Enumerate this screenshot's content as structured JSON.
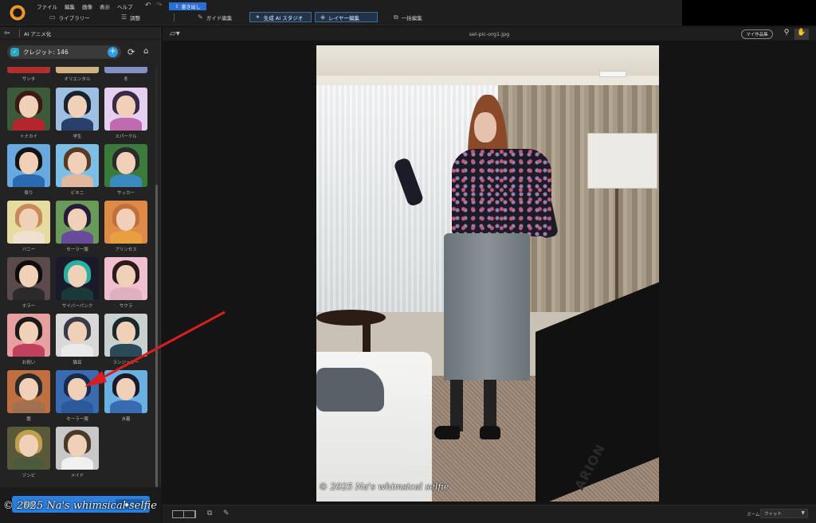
{
  "menu": [
    "ファイル",
    "編集",
    "画像",
    "表示",
    "ヘルプ"
  ],
  "export_label": "書き出し",
  "tabs": {
    "library": "ライブラリー",
    "adjust": "調整",
    "guide_edit": "ガイド編集",
    "gen_ai_studio": "生成 AI スタジオ",
    "layer_edit": "レイヤー編集",
    "batch_edit": "一括編集"
  },
  "left_panel": {
    "title": "AI アニメ化",
    "credits": "クレジット: 146",
    "top_row": [
      "サンタ",
      "オリエンタル",
      "冬"
    ],
    "styles": [
      {
        "label": "トナカイ",
        "hair": "#3a1a12",
        "body": "#b52530",
        "bg": "#3a5a3a"
      },
      {
        "label": "学生",
        "hair": "#1a2230",
        "body": "#28406a",
        "bg": "#9ec0e0"
      },
      {
        "label": "スパークル",
        "hair": "#3a2a4a",
        "body": "#c06ab0",
        "bg": "#e6d0f0"
      },
      {
        "label": "祭り",
        "hair": "#141414",
        "body": "#2a6ab0",
        "bg": "#6aa8e0"
      },
      {
        "label": "ビキニ",
        "hair": "#5a3a22",
        "body": "#e0b8a0",
        "bg": "#7ac0e6"
      },
      {
        "label": "サッカー",
        "hair": "#2a2a2a",
        "body": "#3a8ac0",
        "bg": "#3a7a3a"
      },
      {
        "label": "バニー",
        "hair": "#c88a5a",
        "body": "#f0e0d0",
        "bg": "#e6dca0"
      },
      {
        "label": "セーラー服",
        "hair": "#2a1a3a",
        "body": "#6a4a9a",
        "bg": "#6a9a5a"
      },
      {
        "label": "プリンセス",
        "hair": "#c0703a",
        "body": "#e6a040",
        "bg": "#e08a4a"
      },
      {
        "label": "ホラー",
        "hair": "#0e0e0e",
        "body": "#2a2a2a",
        "bg": "#5a4a4a"
      },
      {
        "label": "サイバーパンク",
        "hair": "#2ab0a0",
        "body": "#1a3a3a",
        "bg": "#1a1a2a"
      },
      {
        "label": "サクラ",
        "hair": "#2a1a1a",
        "body": "#e0b0c0",
        "bg": "#f0c0d0"
      },
      {
        "label": "お祝い",
        "hair": "#1a1a1a",
        "body": "#c04060",
        "bg": "#e6a0a0"
      },
      {
        "label": "猫耳",
        "hair": "#3a3a4a",
        "body": "#eaeaea",
        "bg": "#d8d8d8"
      },
      {
        "label": "ランジェリー",
        "hair": "#1a2a2a",
        "body": "#2a4a5a",
        "bg": "#c8d0d0"
      },
      {
        "label": "龍",
        "hair": "#2a2a2a",
        "body": "#a07050",
        "bg": "#c07040"
      },
      {
        "label": "セーラー服",
        "hair": "#1a2a4a",
        "body": "#2a5a9a",
        "bg": "#3a6ab0"
      },
      {
        "label": "水着",
        "hair": "#1a1a2a",
        "body": "#3a6ab0",
        "bg": "#6ab0e0"
      },
      {
        "label": "ゾンビ",
        "hair": "#c0a050",
        "body": "#4a5a3a",
        "bg": "#5a5a3a"
      },
      {
        "label": "メイド",
        "hair": "#4a3a2a",
        "body": "#f0f0f0",
        "bg": "#c8c8c8"
      }
    ],
    "generate_label": "生成",
    "generate_cost": "3"
  },
  "main": {
    "filename": "sel-pic-org1.jpg",
    "my_works": "マイ作品集",
    "photo_brand": "ARION"
  },
  "bottom": {
    "zoom_label": "ズーム",
    "zoom_value": "フィット"
  },
  "watermark": "2025 Na's whimsical selfie"
}
